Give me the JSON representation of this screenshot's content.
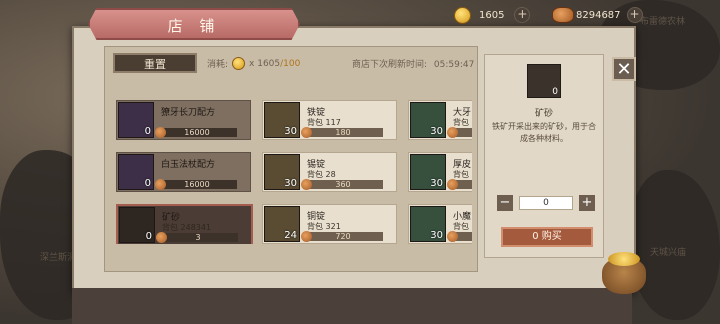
{
  "top_bar": {
    "gold": "1605",
    "copper": "8294687",
    "gold_plus_icon": "plus-icon",
    "copper_plus_icon": "plus-icon"
  },
  "map_labels": [
    "布雷德农林",
    "天城兴庙",
    "深兰斯洞"
  ],
  "shop": {
    "title": "店 铺",
    "reset_label": "重置",
    "cost_label": "消耗:",
    "cost_value": "x 1605",
    "cost_max": "/100",
    "refresh_label": "商店下次刷新时间:",
    "refresh_time": "05:59:47",
    "items": [
      {
        "name": "獠牙长刀配方",
        "sub": "",
        "count": "0",
        "price": "16000",
        "style": "purple",
        "light": false
      },
      {
        "name": "铁锭",
        "sub": "背包 117",
        "count": "30",
        "price": "180",
        "style": "gold",
        "light": true
      },
      {
        "name": "大牙",
        "sub": "背包",
        "count": "30",
        "price": "",
        "style": "green",
        "light": true
      },
      {
        "name": "白玉法杖配方",
        "sub": "",
        "count": "0",
        "price": "16000",
        "style": "purple",
        "light": false
      },
      {
        "name": "锡锭",
        "sub": "背包 28",
        "count": "30",
        "price": "360",
        "style": "gold",
        "light": true
      },
      {
        "name": "厚皮",
        "sub": "背包",
        "count": "30",
        "price": "",
        "style": "green",
        "light": true
      },
      {
        "name": "矿砂",
        "sub": "背包 248341",
        "count": "0",
        "price": "3",
        "style": "dark",
        "light": false,
        "selected": true
      },
      {
        "name": "铜锭",
        "sub": "背包 321",
        "count": "24",
        "price": "720",
        "style": "gold",
        "light": true
      },
      {
        "name": "小魔",
        "sub": "背包",
        "count": "30",
        "price": "",
        "style": "green",
        "light": true
      }
    ]
  },
  "detail": {
    "count": "0",
    "name": "矿砂",
    "desc": "铁矿开采出来的矿砂，用于合成各种材料。",
    "qty": "0",
    "minus": "−",
    "plus": "+",
    "buy_label": "0 购买"
  },
  "close_icon": "close-icon"
}
